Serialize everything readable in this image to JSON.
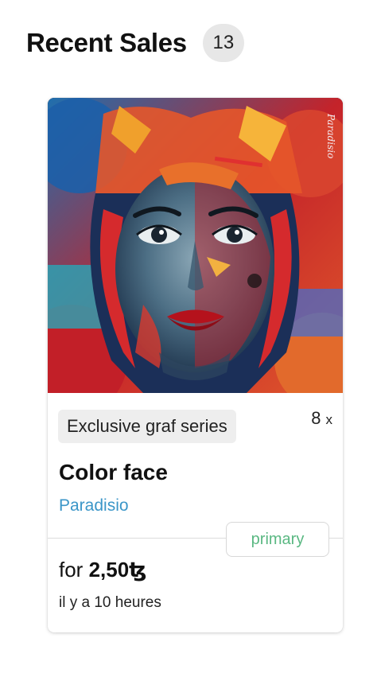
{
  "header": {
    "title": "Recent Sales",
    "count": "13"
  },
  "sale": {
    "artwork_signature": "Paradisio",
    "collection": "Exclusive graf series",
    "edition_count": "8",
    "edition_x": "x",
    "name": "Color face",
    "creator": "Paradisio",
    "market": "primary",
    "price_prefix": "for",
    "price_amount": "2,50ꜩ",
    "time_ago": "il y a 10 heures"
  },
  "colors": {
    "creator_link": "#3b96c8",
    "market_badge_text": "#5ab882",
    "badge_bg": "#e7e7e7"
  }
}
